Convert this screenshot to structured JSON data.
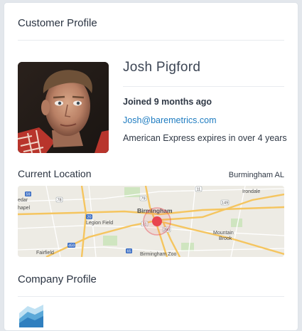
{
  "customer_profile": {
    "title": "Customer Profile",
    "name": "Josh Pigford",
    "joined": "Joined 9 months ago",
    "email": "Josh@baremetrics.com",
    "card_expiry": "American Express expires in over 4 years"
  },
  "location": {
    "title": "Current Location",
    "city": "Burmingham AL",
    "map_labels": {
      "birmingham": "Birmingham",
      "legion_field": "Legion Field",
      "mountain_brook": "Mountain\nBrook",
      "irondale": "Irondale",
      "fairfield": "Fairfield",
      "birmingham_zoo": "Birmingham Zoo",
      "cedar": "edar",
      "hapel": "hapel",
      "hwy_11": "11",
      "hwy_79": "79",
      "hwy_78": "78",
      "hwy_20": "20",
      "hwy_31": "31",
      "hwy_280": "280",
      "hwy_149": "149",
      "hwy_65": "65",
      "hwy_59": "59",
      "hwy_459": "459"
    }
  },
  "company_profile": {
    "title": "Company Profile"
  },
  "colors": {
    "accent_link": "#1e7cc1",
    "map_pin": "#e8444f",
    "map_road": "#f5c55f"
  }
}
